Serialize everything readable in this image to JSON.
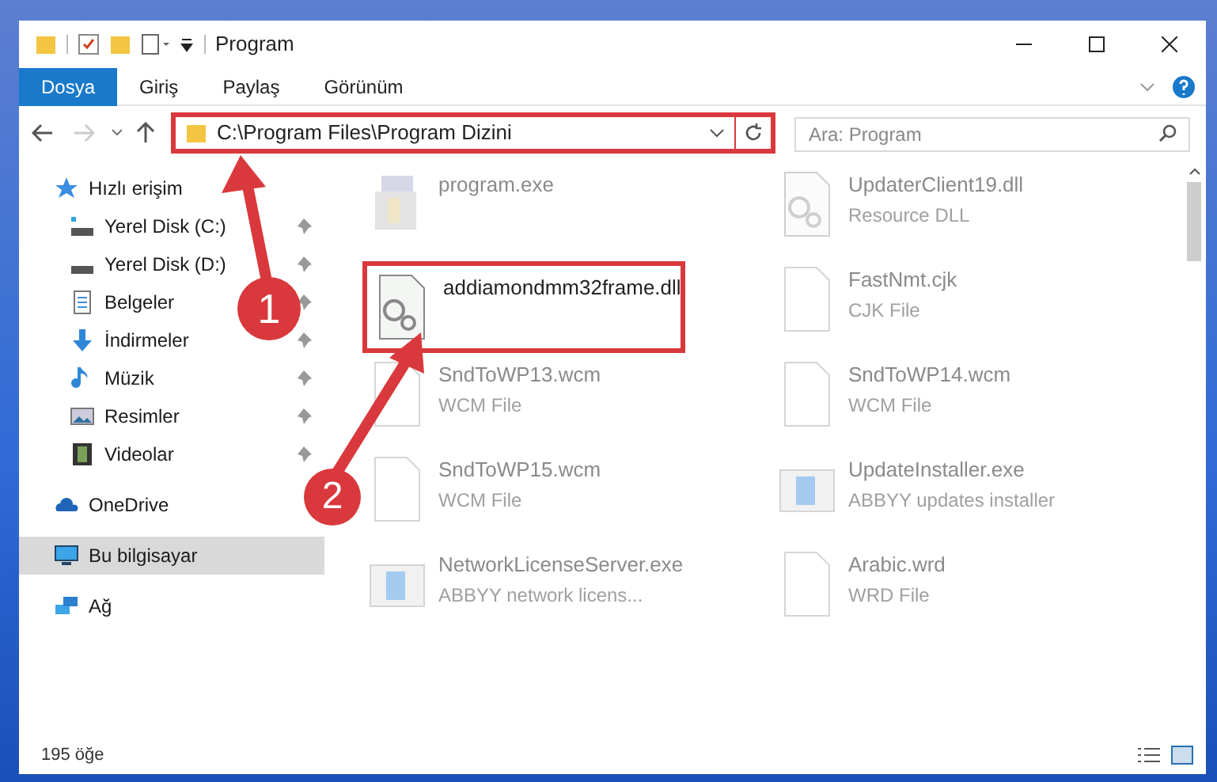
{
  "window": {
    "title": "Program"
  },
  "ribbon_tabs": [
    {
      "label": "Dosya",
      "selected": true
    },
    {
      "label": "Giriş",
      "selected": false
    },
    {
      "label": "Paylaş",
      "selected": false
    },
    {
      "label": "Görünüm",
      "selected": false
    }
  ],
  "address_bar": {
    "path": "C:\\Program Files\\Program Dizini",
    "highlighted": true
  },
  "search": {
    "placeholder": "Ara: Program"
  },
  "sidebar": {
    "items": [
      {
        "label": "Hızlı erişim",
        "kind": "star",
        "selected": false,
        "children": [
          {
            "label": "Yerel Disk (C:)",
            "kind": "drive-c",
            "pinned": true,
            "selected": false
          },
          {
            "label": "Yerel Disk (D:)",
            "kind": "drive",
            "pinned": true,
            "selected": false
          },
          {
            "label": "Belgeler",
            "kind": "doc",
            "pinned": true,
            "selected": false
          },
          {
            "label": "İndirmeler",
            "kind": "download",
            "pinned": true,
            "selected": false
          },
          {
            "label": "Müzik",
            "kind": "music",
            "pinned": true,
            "selected": false
          },
          {
            "label": "Resimler",
            "kind": "image",
            "pinned": true,
            "selected": false
          },
          {
            "label": "Videolar",
            "kind": "video",
            "pinned": true,
            "selected": false
          }
        ]
      },
      {
        "label": "OneDrive",
        "kind": "cloud",
        "selected": false
      },
      {
        "label": "Bu bilgisayar",
        "kind": "pc",
        "selected": true
      },
      {
        "label": "Ağ",
        "kind": "network",
        "selected": false
      }
    ]
  },
  "files": [
    {
      "name": "program.exe",
      "kind": "installer",
      "faded": true,
      "highlighted": false
    },
    {
      "name": "UpdaterClient19.dll",
      "type": "Resource DLL",
      "kind": "dll",
      "faded": true,
      "highlighted": false
    },
    {
      "name": "addiamondmm32frame.dll",
      "kind": "dll",
      "faded": false,
      "highlighted": true
    },
    {
      "name": "FastNmt.cjk",
      "type": "CJK File",
      "kind": "blank",
      "faded": true,
      "highlighted": false
    },
    {
      "name": "SndToWP13.wcm",
      "type": "WCM File",
      "kind": "blank",
      "faded": true,
      "highlighted": false
    },
    {
      "name": "SndToWP14.wcm",
      "type": "WCM File",
      "kind": "blank",
      "faded": true,
      "highlighted": false
    },
    {
      "name": "SndToWP15.wcm",
      "type": "WCM File",
      "kind": "blank",
      "faded": true,
      "highlighted": false
    },
    {
      "name": "UpdateInstaller.exe",
      "type": "ABBYY updates installer",
      "kind": "app",
      "faded": true,
      "highlighted": false
    },
    {
      "name": "NetworkLicenseServer.exe",
      "type": "ABBYY network licens...",
      "kind": "app",
      "faded": true,
      "highlighted": false
    },
    {
      "name": "Arabic.wrd",
      "type": "WRD File",
      "kind": "blank",
      "faded": true,
      "highlighted": false
    }
  ],
  "status_bar": {
    "count": "195 öğe"
  },
  "annotations": [
    {
      "number": "1"
    },
    {
      "number": "2"
    }
  ]
}
